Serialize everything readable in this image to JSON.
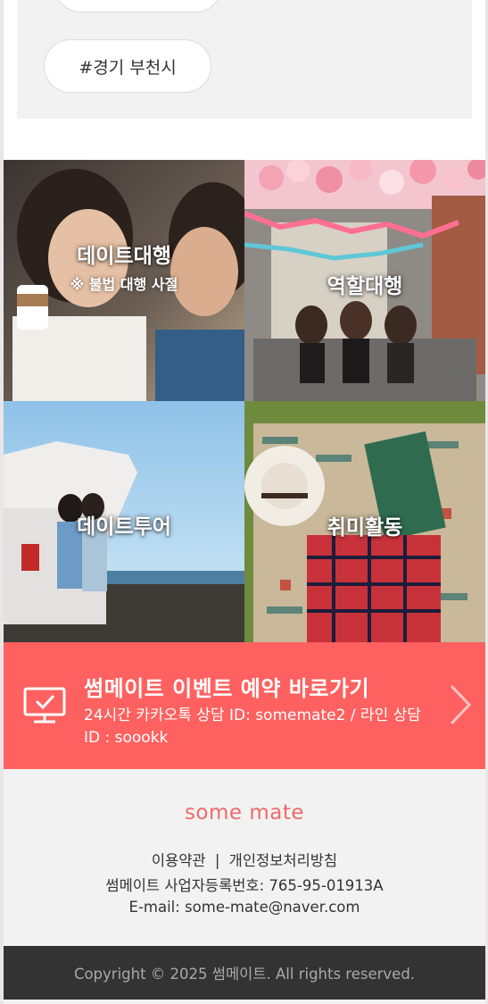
{
  "tags": {
    "top_partial": "",
    "main": "#경기 부천시"
  },
  "services": [
    {
      "title": "데이트대행",
      "note": "※ 불법 대행 사절"
    },
    {
      "title": "역할대행",
      "note": ""
    },
    {
      "title": "데이트투어",
      "note": ""
    },
    {
      "title": "취미활동",
      "note": ""
    }
  ],
  "banner": {
    "title": "썸메이트 이벤트 예약 바로가기",
    "subtitle": "24시간 카카오톡 상담 ID: somemate2 / 라인 상담ID : soookk",
    "icon": "monitor-check-icon",
    "arrow_icon": "chevron-right-icon",
    "color": "#fe615f"
  },
  "footer": {
    "logo": "some mate",
    "terms": "이용약관",
    "separator": "|",
    "privacy": "개인정보처리방침",
    "business": "썸메이트 사업자등록번호: 765-95-01913A",
    "email": "E-mail: some-mate@naver.com",
    "copyright": "Copyright © 2025 썸메이트. All rights reserved."
  }
}
